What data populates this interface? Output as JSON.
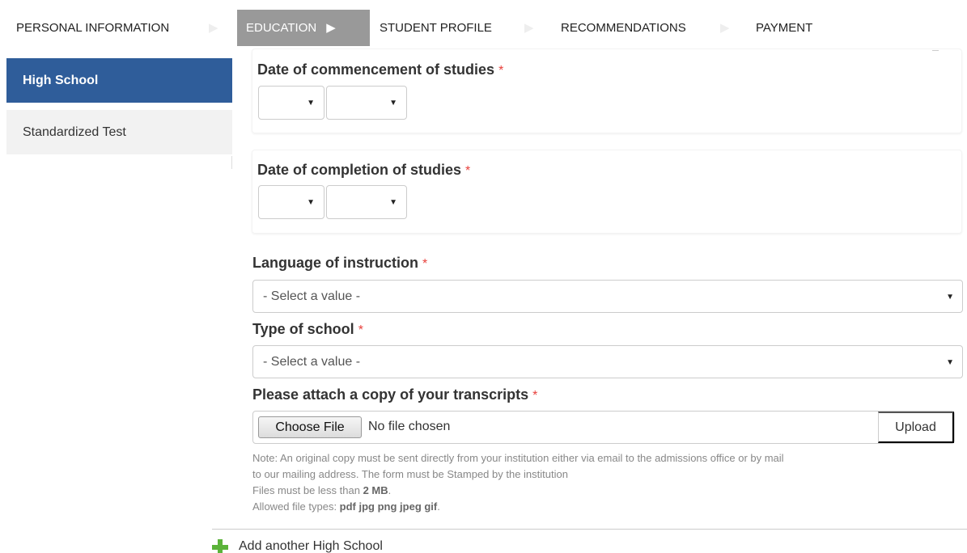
{
  "steps": [
    {
      "label": "PERSONAL INFORMATION"
    },
    {
      "label": "EDUCATION"
    },
    {
      "label": "STUDENT PROFILE"
    },
    {
      "label": "RECOMMENDATIONS"
    },
    {
      "label": "PAYMENT"
    }
  ],
  "icons": {
    "step_arrow": "▶",
    "caret": "▼"
  },
  "sidebar": {
    "items": [
      {
        "label": "High School"
      },
      {
        "label": "Standardized Test"
      }
    ]
  },
  "form": {
    "commencement_label": "Date of commencement of studies",
    "completion_label": "Date of completion of studies",
    "language_label": "Language of instruction",
    "language_value": "- Select a value -",
    "school_type_label": "Type of school",
    "school_type_value": "- Select a value -",
    "transcripts_label": "Please attach a copy of your transcripts",
    "required_marker": "*",
    "choose_file": "Choose File",
    "no_file": "No file chosen",
    "upload": "Upload",
    "note_line1": "Note: An original copy must be sent directly from your institution either via email to the admissions office or by mail",
    "note_line2": "to our mailing address. The form must be Stamped by the institution",
    "size_prefix": "Files must be less than ",
    "size_value": "2 MB",
    "size_suffix": ".",
    "types_prefix": "Allowed file types: ",
    "types_value": "pdf jpg png jpeg gif",
    "types_suffix": ".",
    "add_another": "Add another High School"
  },
  "colors": {
    "active_step_bg": "#999999",
    "sidebar_active_bg": "#2f5d9a",
    "required": "#e8413c",
    "add_icon": "#5bb33a"
  }
}
